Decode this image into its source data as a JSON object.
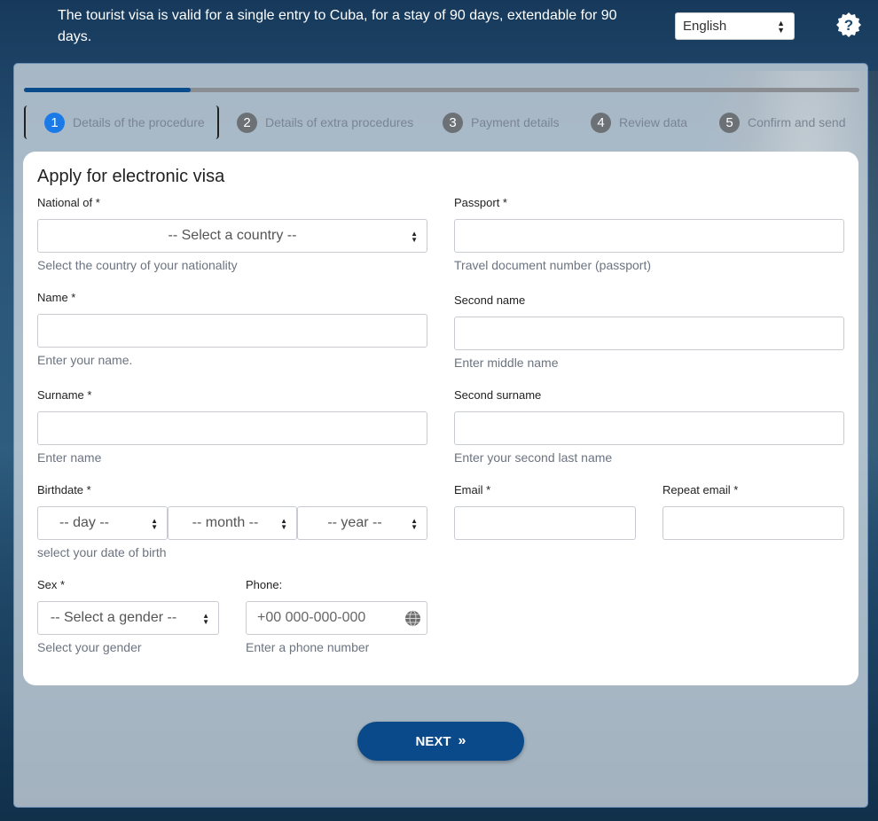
{
  "header": {
    "notice": "The tourist visa is valid for a single entry to Cuba, for a stay of 90 days, extendable for 90 days.",
    "language": "English"
  },
  "progress": {
    "percent": 20
  },
  "steps": [
    {
      "num": "1",
      "label": "Details of the procedure"
    },
    {
      "num": "2",
      "label": "Details of extra procedures"
    },
    {
      "num": "3",
      "label": "Payment details"
    },
    {
      "num": "4",
      "label": "Review data"
    },
    {
      "num": "5",
      "label": "Confirm and send"
    }
  ],
  "form": {
    "title": "Apply for electronic visa",
    "national": {
      "label": "National of *",
      "value": "-- Select a country --",
      "help": "Select the country of your nationality"
    },
    "passport": {
      "label": "Passport *",
      "help": "Travel document number (passport)"
    },
    "name": {
      "label": "Name *",
      "help": "Enter your name."
    },
    "second_name": {
      "label": "Second name",
      "help": "Enter middle name"
    },
    "surname": {
      "label": "Surname *",
      "help": "Enter name"
    },
    "second_surname": {
      "label": "Second surname",
      "help": "Enter your second last name"
    },
    "birthdate": {
      "label": "Birthdate *",
      "day": "-- day --",
      "month": "-- month --",
      "year": "-- year --",
      "help": "select your date of birth"
    },
    "email": {
      "label": "Email *"
    },
    "repeat_email": {
      "label": "Repeat email *"
    },
    "sex": {
      "label": "Sex *",
      "value": "-- Select a gender --",
      "help": "Select your gender"
    },
    "phone": {
      "label": "Phone:",
      "placeholder": "+00 000-000-000",
      "help": "Enter a phone number"
    }
  },
  "actions": {
    "next_label": "NEXT",
    "next_icon": "double-chevron-right"
  }
}
